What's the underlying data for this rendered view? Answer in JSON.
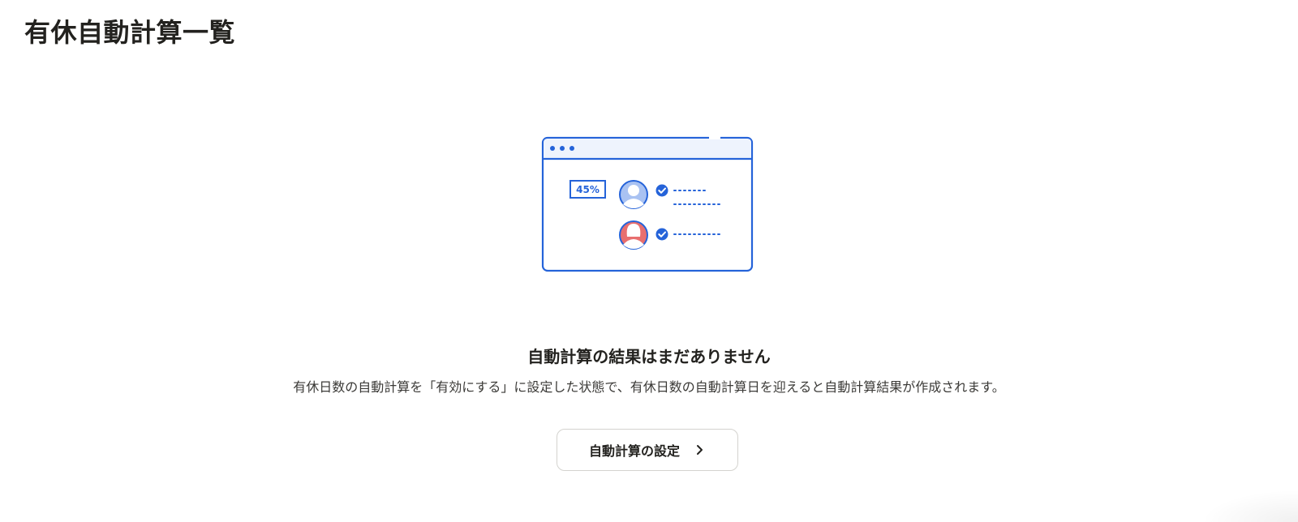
{
  "page": {
    "title": "有休自動計算一覧"
  },
  "illustration": {
    "badge_text": "45%",
    "primary_color": "#2563d9",
    "frame_fill": "#eef3fd",
    "avatar_male_color": "#a9c2f2",
    "avatar_female_color": "#e86f6f"
  },
  "empty_state": {
    "title": "自動計算の結果はまだありません",
    "description": "有休日数の自動計算を「有効にする」に設定した状態で、有休日数の自動計算日を迎えると自動計算結果が作成されます。",
    "button_label": "自動計算の設定"
  }
}
